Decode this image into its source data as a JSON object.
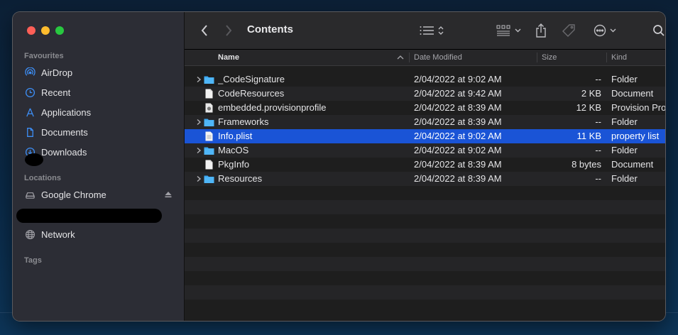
{
  "window": {
    "title": "Contents"
  },
  "sidebar": {
    "favourites_title": "Favourites",
    "favourites": [
      {
        "label": "AirDrop",
        "icon": "airdrop-icon"
      },
      {
        "label": "Recent",
        "icon": "clock-icon"
      },
      {
        "label": "Applications",
        "icon": "applications-icon"
      },
      {
        "label": "Documents",
        "icon": "document-icon"
      },
      {
        "label": "Downloads",
        "icon": "download-icon"
      }
    ],
    "locations_title": "Locations",
    "locations": [
      {
        "label": "Google Chrome",
        "icon": "drive-icon"
      },
      {
        "label": "Network",
        "icon": "network-icon"
      }
    ],
    "tags_title": "Tags"
  },
  "columns": {
    "name": "Name",
    "date": "Date Modified",
    "size": "Size",
    "kind": "Kind"
  },
  "files": [
    {
      "name": "_CodeSignature",
      "date": "2/04/2022 at 9:02 AM",
      "size": "--",
      "kind": "Folder",
      "type": "folder",
      "expandable": true
    },
    {
      "name": "CodeResources",
      "date": "2/04/2022 at 9:42 AM",
      "size": "2 KB",
      "kind": "Document",
      "type": "doc",
      "expandable": false
    },
    {
      "name": "embedded.provisionprofile",
      "date": "2/04/2022 at 8:39 AM",
      "size": "12 KB",
      "kind": "Provision Pro",
      "type": "profile",
      "expandable": false
    },
    {
      "name": "Frameworks",
      "date": "2/04/2022 at 8:39 AM",
      "size": "--",
      "kind": "Folder",
      "type": "folder",
      "expandable": true
    },
    {
      "name": "Info.plist",
      "date": "2/04/2022 at 9:02 AM",
      "size": "11 KB",
      "kind": "property list",
      "type": "plist",
      "expandable": false,
      "selected": true
    },
    {
      "name": "MacOS",
      "date": "2/04/2022 at 9:02 AM",
      "size": "--",
      "kind": "Folder",
      "type": "folder",
      "expandable": true
    },
    {
      "name": "PkgInfo",
      "date": "2/04/2022 at 8:39 AM",
      "size": "8 bytes",
      "kind": "Document",
      "type": "doc",
      "expandable": false
    },
    {
      "name": "Resources",
      "date": "2/04/2022 at 8:39 AM",
      "size": "--",
      "kind": "Folder",
      "type": "folder",
      "expandable": true
    }
  ],
  "colors": {
    "selection": "#1a54d6",
    "folder": "#3aa6f0",
    "sidebar_icon": "#3d8ef5"
  }
}
